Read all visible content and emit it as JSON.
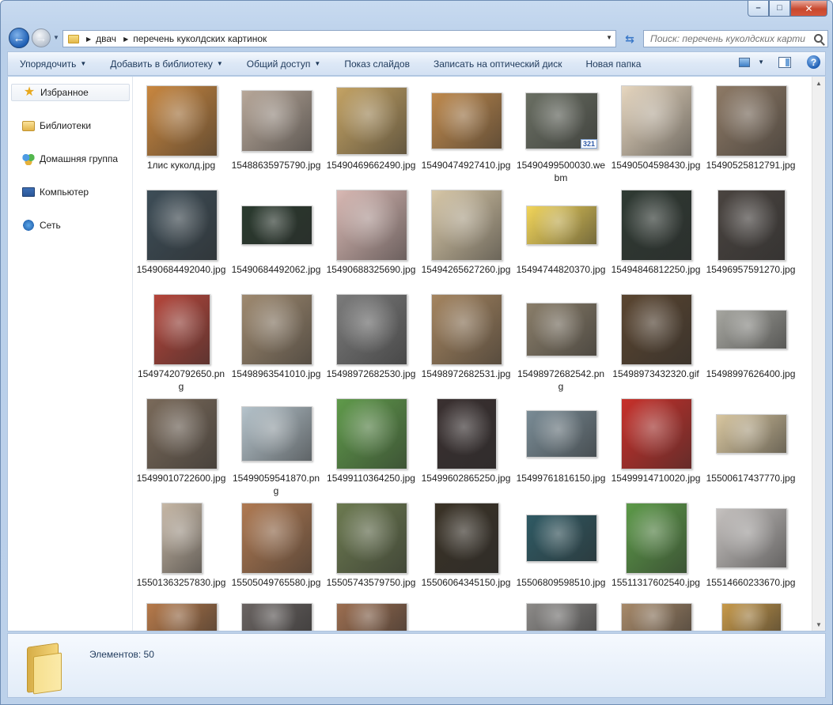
{
  "window": {
    "caption": {
      "minimize": "–",
      "maximize": "□",
      "close": "✕"
    }
  },
  "nav": {
    "back": "←",
    "forward": "→"
  },
  "address": {
    "breadcrumbs": [
      "двач",
      "перечень куколдских картинок"
    ]
  },
  "search": {
    "placeholder": "Поиск: перечень куколдских карти..."
  },
  "toolbar": {
    "organize": "Упорядочить",
    "add_to_library": "Добавить в библиотеку",
    "share": "Общий доступ",
    "slideshow": "Показ слайдов",
    "burn": "Записать на оптический диск",
    "new_folder": "Новая папка",
    "help": "?"
  },
  "sidebar": {
    "items": [
      {
        "label": "Избранное"
      },
      {
        "label": "Библиотеки"
      },
      {
        "label": "Домашняя группа"
      },
      {
        "label": "Компьютер"
      },
      {
        "label": "Сеть"
      }
    ]
  },
  "files": [
    {
      "name": "1лис куколд.jpg",
      "tone": "#c9873f"
    },
    {
      "name": "15488635975790.jpg",
      "tone": "#b8a89a"
    },
    {
      "name": "15490469662490.jpg",
      "tone": "#c4a364"
    },
    {
      "name": "15490474927410.jpg",
      "tone": "#c08a4d"
    },
    {
      "name": "15490499500030.webm",
      "tone": "#6a6f63",
      "badge": "321"
    },
    {
      "name": "15490504598430.jpg",
      "tone": "#e7d7c0"
    },
    {
      "name": "15490525812791.jpg",
      "tone": "#8e7a66"
    },
    {
      "name": "15490684492040.jpg",
      "tone": "#3d4d57"
    },
    {
      "name": "15490684492062.jpg",
      "tone": "#2a3a2e"
    },
    {
      "name": "15490688325690.jpg",
      "tone": "#d9b9b4"
    },
    {
      "name": "15494265627260.jpg",
      "tone": "#d8c8a8"
    },
    {
      "name": "15494744820370.jpg",
      "tone": "#f2d55a"
    },
    {
      "name": "15494846812250.jpg",
      "tone": "#2f3a33"
    },
    {
      "name": "15496957591270.jpg",
      "tone": "#4a4440"
    },
    {
      "name": "15497420792650.png",
      "tone": "#b5453a"
    },
    {
      "name": "15498963541010.jpg",
      "tone": "#9f8a70"
    },
    {
      "name": "15498972682530.jpg",
      "tone": "#7b7b7b"
    },
    {
      "name": "15498972682531.jpg",
      "tone": "#a58560"
    },
    {
      "name": "15498972682542.png",
      "tone": "#8a7e6a"
    },
    {
      "name": "15498973432320.gif",
      "tone": "#5a4530"
    },
    {
      "name": "15498997626400.jpg",
      "tone": "#a6a6a0"
    },
    {
      "name": "15499010722600.jpg",
      "tone": "#7a6a5a"
    },
    {
      "name": "15499059541870.png",
      "tone": "#b6c4cc"
    },
    {
      "name": "15499110364250.jpg",
      "tone": "#5f9a4a"
    },
    {
      "name": "15499602865250.jpg",
      "tone": "#3a3030"
    },
    {
      "name": "15499761816150.jpg",
      "tone": "#7a8c96"
    },
    {
      "name": "15499914710020.jpg",
      "tone": "#c8302a"
    },
    {
      "name": "15500617437770.jpg",
      "tone": "#d9c7a0"
    },
    {
      "name": "15501363257830.jpg",
      "tone": "#c7b8a6"
    },
    {
      "name": "15505049765580.jpg",
      "tone": "#b07a52"
    },
    {
      "name": "15505743579750.jpg",
      "tone": "#6c7a50"
    },
    {
      "name": "15506064345150.jpg",
      "tone": "#3a3226"
    },
    {
      "name": "15506809598510.jpg",
      "tone": "#2f5a64"
    },
    {
      "name": "15511317602540.jpg",
      "tone": "#5c9a48"
    },
    {
      "name": "15514660233670.jpg",
      "tone": "#c6c2c0"
    },
    {
      "name": "",
      "tone": "#b77a4a"
    },
    {
      "name": "",
      "tone": "#6a6462"
    },
    {
      "name": "",
      "tone": "#9c6e50"
    },
    {
      "name": "",
      "tone": "#222222"
    },
    {
      "name": "",
      "tone": "#8c8a88"
    },
    {
      "name": "",
      "tone": "#a88a6a"
    },
    {
      "name": "",
      "tone": "#c89a4a"
    }
  ],
  "status": {
    "items_count": "Элементов: 50"
  },
  "colors": {
    "accent": "#1e395b",
    "link_blue": "#2b58a8"
  }
}
